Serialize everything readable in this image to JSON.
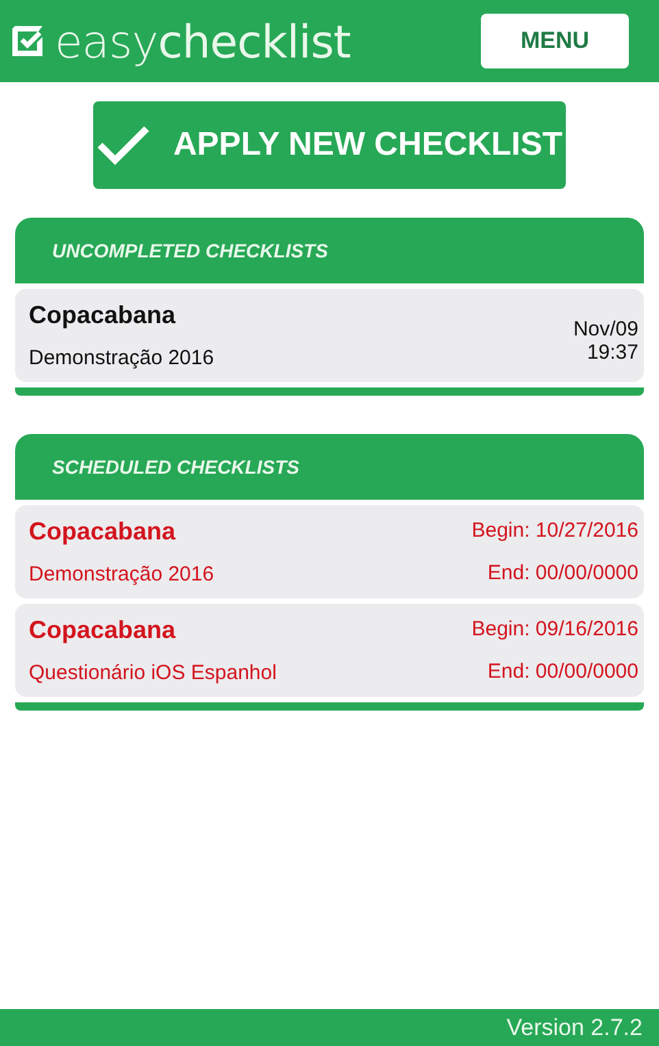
{
  "header": {
    "logo": "easy**checklist**",
    "menu_button": "MENU"
  },
  "apply_button": "APPLY NEW CHECKLIST",
  "sections": [
    {
      "title": "UNCOMPLETED CHECKLISTS",
      "rows": [
        {
          "kind": "pending",
          "title": "Copacabana",
          "subtitle": "Demonstração 2016",
          "right_top": "Nov/09",
          "right_bottom": "19:37"
        }
      ]
    },
    {
      "title": "SCHEDULED CHECKLISTS",
      "rows": [
        {
          "kind": "scheduled",
          "title": "Copacabana",
          "subtitle": "Demonstração 2016",
          "right_top": "Begin: 10/27/2016",
          "right_bottom": "End: 00/00/0000"
        },
        {
          "kind": "scheduled",
          "title": "Copacabana",
          "subtitle": "Questionário iOS Espanhol",
          "right_top": "Begin: 09/16/2016",
          "right_bottom": "End: 00/00/0000"
        }
      ]
    }
  ],
  "footer": {
    "version": "Version 2.7.2"
  }
}
